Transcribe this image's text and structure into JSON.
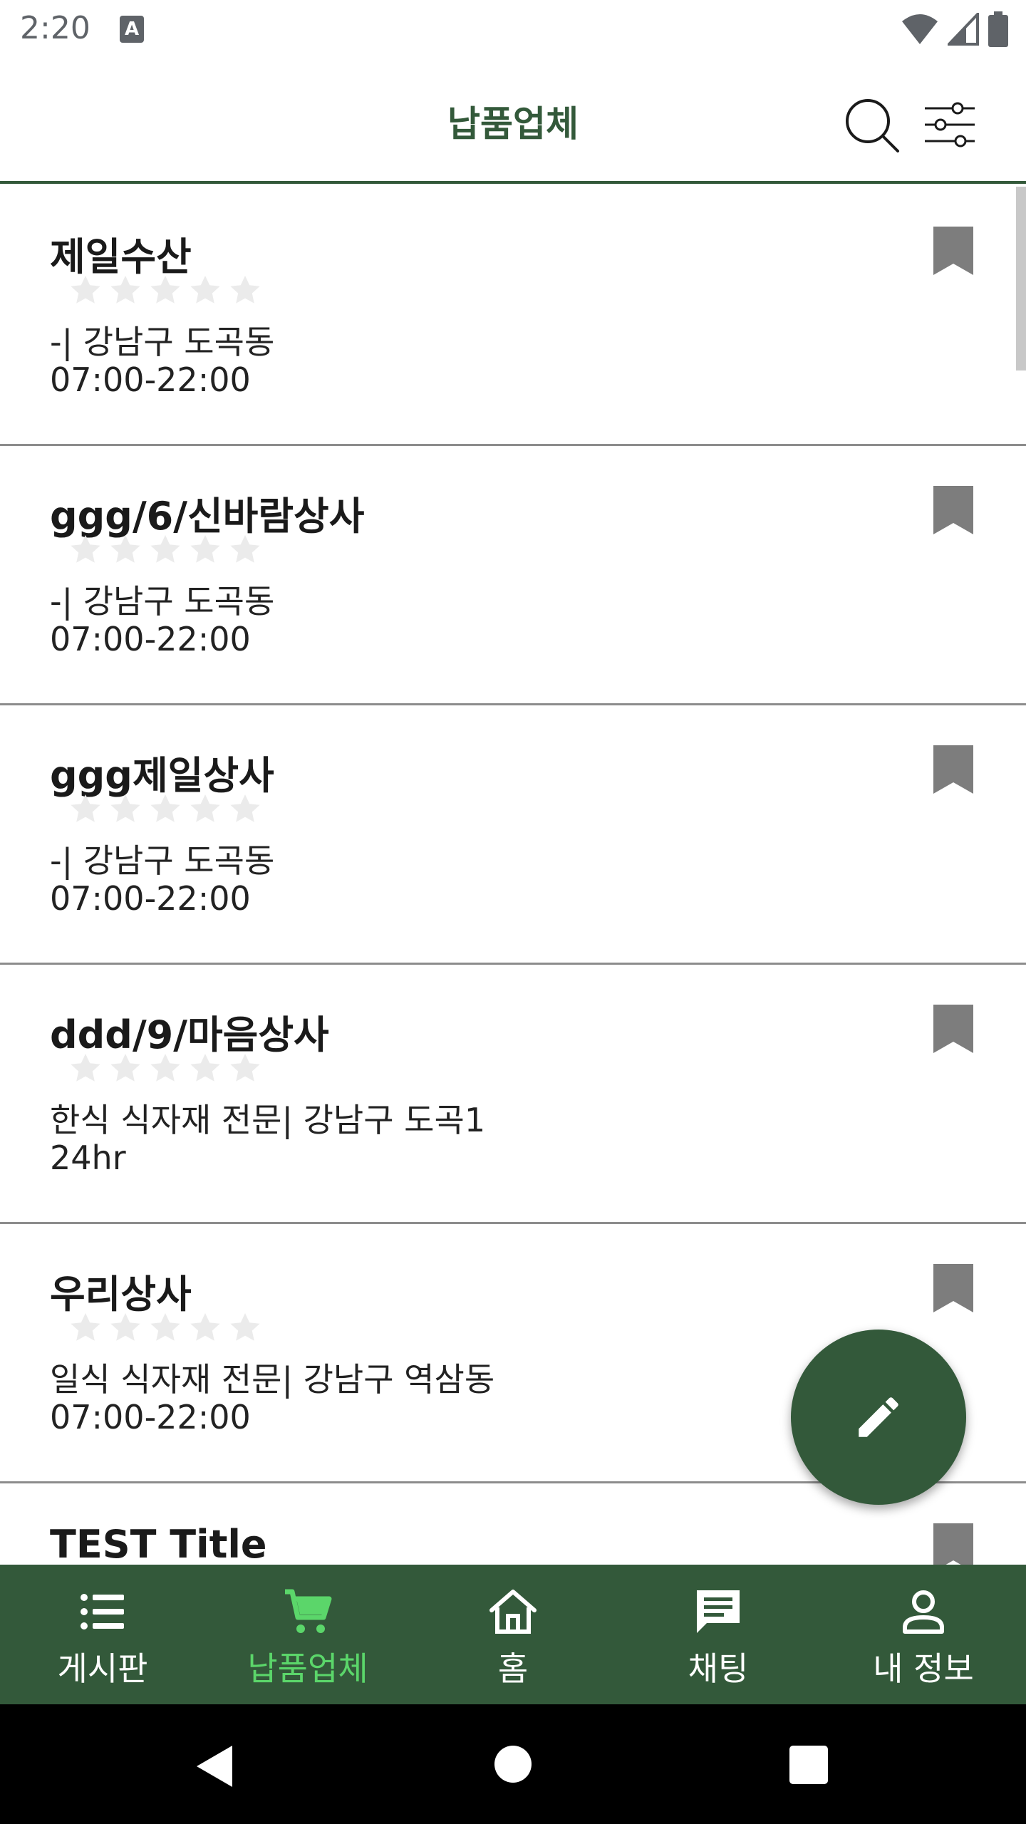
{
  "status_bar": {
    "time": "2:20",
    "notification_letter": "A"
  },
  "app_bar": {
    "title": "납품업체",
    "search_icon": "search-icon",
    "filter_icon": "filter-sliders-icon"
  },
  "vendors": [
    {
      "name": "제일수산",
      "rating": 0,
      "category_location": "-| 강남구 도곡동",
      "hours": "07:00-22:00",
      "bookmarked": true
    },
    {
      "name": "ggg/6/신바람상사",
      "rating": 0,
      "category_location": "-| 강남구 도곡동",
      "hours": "07:00-22:00",
      "bookmarked": true
    },
    {
      "name": "ggg제일상사",
      "rating": 0,
      "category_location": "-| 강남구 도곡동",
      "hours": "07:00-22:00",
      "bookmarked": true
    },
    {
      "name": "ddd/9/마음상사",
      "rating": 0,
      "category_location": "한식 식자재 전문| 강남구 도곡1",
      "hours": "24hr",
      "bookmarked": true
    },
    {
      "name": "우리상사",
      "rating": 0,
      "category_location": "일식 식자재 전문| 강남구 역삼동",
      "hours": "07:00-22:00",
      "bookmarked": true
    },
    {
      "name": "TEST Title",
      "rating": 0,
      "category_location": "",
      "hours": "",
      "bookmarked": true
    }
  ],
  "fab": {
    "icon": "pencil-icon"
  },
  "bottom_nav": {
    "items": [
      {
        "label": "게시판",
        "icon": "list-icon",
        "active": false
      },
      {
        "label": "납품업체",
        "icon": "cart-icon",
        "active": true
      },
      {
        "label": "홈",
        "icon": "home-icon",
        "active": false
      },
      {
        "label": "채팅",
        "icon": "chat-icon",
        "active": false
      },
      {
        "label": "내 정보",
        "icon": "person-icon",
        "active": false
      }
    ]
  },
  "colors": {
    "primary": "#33593a",
    "active_nav": "#5bd66a",
    "bookmark": "#7d7d7d",
    "star_empty": "#ebebeb",
    "divider": "#8c8c8c"
  }
}
